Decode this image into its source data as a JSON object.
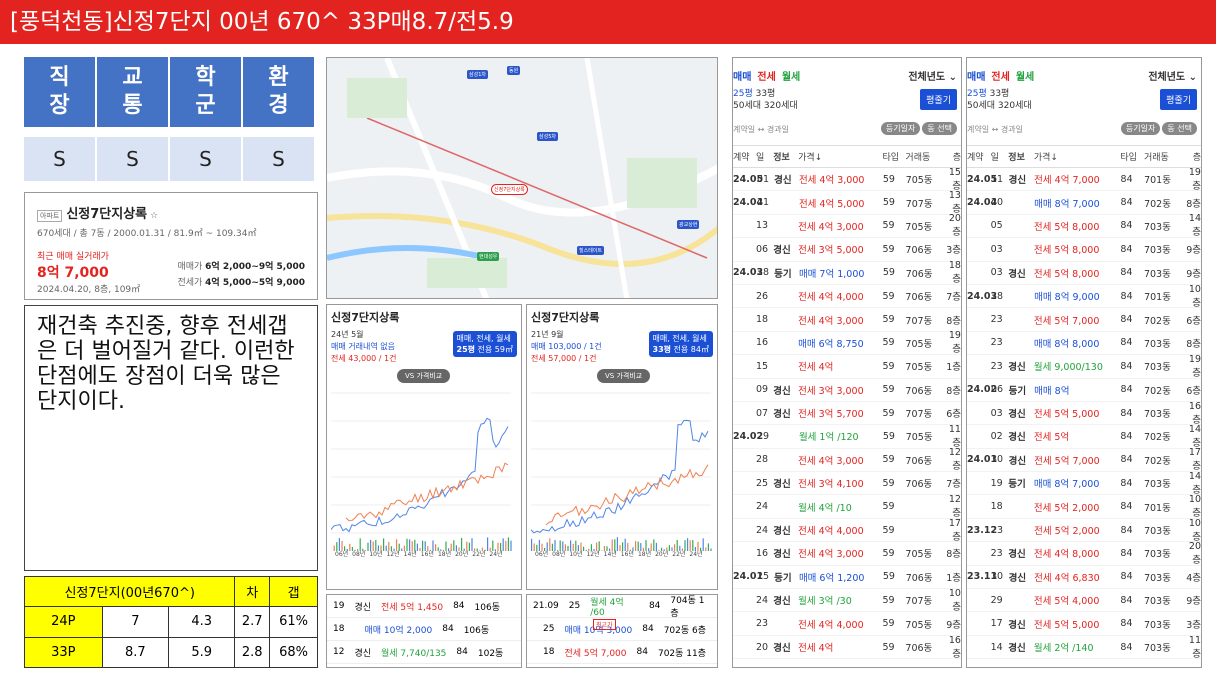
{
  "title": "[풍덕천동]신정7단지 00년 670^ 33P매8.7/전5.9",
  "categories": [
    {
      "head": "직\n장",
      "val": "S"
    },
    {
      "head": "교\n통",
      "val": "S"
    },
    {
      "head": "학\n군",
      "val": "S"
    },
    {
      "head": "환\n경",
      "val": "S"
    }
  ],
  "summary": {
    "badge": "아파트",
    "name": "신정7단지상록",
    "star": "☆",
    "info": "670세대 / 총 7동 / 2000.01.31 / 81.9㎡ ~ 109.34㎡",
    "recent_label": "최근 매매 실거래가",
    "recent_price": "8억 7,000",
    "recent_date": "2024.04.20, 8층, 109㎡",
    "sale_label": "매매가",
    "sale_range": "6억 2,000~9억 5,000",
    "jeonse_label": "전세가",
    "jeonse_range": "4억 5,000~5억 9,000"
  },
  "comment": "재건축 추진중, 향후 전세갭은 더 벌어질거 같다. 이런한 단점에도 장점이 더욱 많은 단지이다.",
  "ytable": {
    "header": [
      "신정7단지(00년670^)",
      "",
      "",
      "차",
      "갭"
    ],
    "rows": [
      [
        "24P",
        "7",
        "4.3",
        "2.7",
        "61%"
      ],
      [
        "33P",
        "8.7",
        "5.9",
        "2.8",
        "68%"
      ]
    ]
  },
  "map": {
    "pins": [
      {
        "label": "삼성1차"
      },
      {
        "label": "동원"
      },
      {
        "label": "신정7단지상록",
        "highlight": true
      },
      {
        "label": "현대성우"
      },
      {
        "label": "힐스테이트"
      },
      {
        "label": "삼성5차"
      },
      {
        "label": "광교상현"
      }
    ]
  },
  "chart1": {
    "title": "신정7단지상록",
    "month": "24년 5월",
    "line1": "매매 거래내역 없음",
    "line2": "전세 43,000 / 1건",
    "btn": "매매, 전세, 월세",
    "size": "25평",
    "sizesub": "전용 59㎡",
    "vs": "VS 가격비교",
    "years": [
      "06년",
      "08년",
      "10년",
      "12년",
      "14년",
      "16년",
      "18년",
      "20년",
      "22년",
      "24년"
    ]
  },
  "chart2": {
    "title": "신정7단지상록",
    "month": "21년 9월",
    "line1": "매매 103,000 / 1건",
    "line2": "전세 57,000 / 1건",
    "btn": "매매, 전세, 월세",
    "size": "33평",
    "sizesub": "전용 84㎡",
    "vs": "VS 가격비교",
    "years": [
      "06년",
      "08년",
      "10년",
      "12년",
      "14년",
      "16년",
      "18년",
      "20년",
      "22년",
      "24년"
    ]
  },
  "bottom1": [
    [
      "19",
      "경신",
      "전세 5억 1,450",
      "84",
      "106동"
    ],
    [
      "18",
      "",
      "매매 10억 2,000",
      "84",
      "106동"
    ],
    [
      "12",
      "경신",
      "월세 7,740/135",
      "84",
      "102동"
    ]
  ],
  "bottom2": [
    [
      "21.09",
      "25",
      "월세 4억 /60",
      "84",
      "704동 1층"
    ],
    [
      "",
      "25",
      "매매 10억 3,000",
      "84",
      "702동 6층"
    ],
    [
      "",
      "18",
      "전세 5억 7,000",
      "84",
      "702동 11층"
    ]
  ],
  "bottom2_tag": "최고가",
  "tx1": {
    "tabs": [
      "매매",
      "전세",
      "월세"
    ],
    "year": "전체년도 ⌄",
    "sizes": [
      [
        "25평",
        "33평"
      ],
      [
        "50세대",
        "320세대"
      ]
    ],
    "btn": "평줄기",
    "sub": "계약일 ↔ 경과일",
    "chips": [
      "등기일자",
      "동 선택"
    ],
    "cols": [
      "계약",
      "일",
      "정보",
      "가격↓",
      "타입",
      "거래동",
      "층"
    ],
    "rows": [
      [
        "24.05",
        "01",
        "경신",
        "전세 4억 3,000",
        "59",
        "705동",
        "15층"
      ],
      [
        "24.04",
        "21",
        "",
        "전세 4억 5,000",
        "59",
        "707동",
        "13층"
      ],
      [
        "",
        "13",
        "",
        "전세 4억 3,000",
        "59",
        "705동",
        "20층"
      ],
      [
        "",
        "06",
        "경신",
        "전세 3억 5,000",
        "59",
        "706동",
        "3층"
      ],
      [
        "24.03",
        "28",
        "등기",
        "매매 7억 1,000",
        "59",
        "706동",
        "18층"
      ],
      [
        "",
        "26",
        "",
        "전세 4억 4,000",
        "59",
        "706동",
        "7층"
      ],
      [
        "",
        "18",
        "",
        "전세 4억 3,000",
        "59",
        "707동",
        "8층"
      ],
      [
        "",
        "16",
        "",
        "매매 6억 8,750",
        "59",
        "705동",
        "19층"
      ],
      [
        "",
        "15",
        "",
        "전세 4억",
        "59",
        "705동",
        "1층"
      ],
      [
        "",
        "09",
        "경신",
        "전세 3억 3,000",
        "59",
        "706동",
        "8층"
      ],
      [
        "",
        "07",
        "경신",
        "전세 3억 5,700",
        "59",
        "707동",
        "6층"
      ],
      [
        "24.02",
        "29",
        "",
        "월세 1억 /120",
        "59",
        "705동",
        "11층"
      ],
      [
        "",
        "28",
        "",
        "전세 4억 3,000",
        "59",
        "706동",
        "12층"
      ],
      [
        "",
        "25",
        "경신",
        "전세 3억 4,100",
        "59",
        "706동",
        "7층"
      ],
      [
        "",
        "24",
        "",
        "월세 4억 /10",
        "59",
        "",
        "12층"
      ],
      [
        "",
        "24",
        "경신",
        "전세 4억 4,000",
        "59",
        "",
        "17층"
      ],
      [
        "",
        "16",
        "경신",
        "전세 4억 3,000",
        "59",
        "705동",
        "8층"
      ],
      [
        "24.01",
        "25",
        "등기",
        "매매 6억 1,200",
        "59",
        "706동",
        "1층"
      ],
      [
        "",
        "24",
        "경신",
        "월세 3억 /30",
        "59",
        "707동",
        "10층"
      ],
      [
        "",
        "23",
        "",
        "전세 4억 4,000",
        "59",
        "705동",
        "9층"
      ],
      [
        "",
        "20",
        "경신",
        "전세 4억",
        "59",
        "706동",
        "16층"
      ]
    ]
  },
  "tx2": {
    "tabs": [
      "매매",
      "전세",
      "월세"
    ],
    "year": "전체년도 ⌄",
    "sizes": [
      [
        "25평",
        "33평"
      ],
      [
        "50세대",
        "320세대"
      ]
    ],
    "btn": "평줄기",
    "sub": "계약일 ↔ 경과일",
    "chips": [
      "등기일자",
      "동 선택"
    ],
    "cols": [
      "계약",
      "일",
      "정보",
      "가격↓",
      "타입",
      "거래동",
      "층"
    ],
    "rows": [
      [
        "24.05",
        "11",
        "경신",
        "전세 4억 7,000",
        "84",
        "701동",
        "19층"
      ],
      [
        "24.04",
        "20",
        "",
        "매매 8억 7,000",
        "84",
        "702동",
        "8층"
      ],
      [
        "",
        "05",
        "",
        "전세 5억 8,000",
        "84",
        "703동",
        "14층"
      ],
      [
        "",
        "03",
        "",
        "전세 5억 8,000",
        "84",
        "703동",
        "9층"
      ],
      [
        "",
        "03",
        "경신",
        "전세 5억 8,000",
        "84",
        "703동",
        "9층"
      ],
      [
        "24.03",
        "28",
        "",
        "매매 8억 9,000",
        "84",
        "701동",
        "10층"
      ],
      [
        "",
        "23",
        "",
        "전세 5억 7,000",
        "84",
        "702동",
        "6층"
      ],
      [
        "",
        "23",
        "",
        "매매 8억 8,000",
        "84",
        "703동",
        "8층"
      ],
      [
        "",
        "23",
        "경신",
        "월세 9,000/130",
        "84",
        "703동",
        "19층"
      ],
      [
        "24.02",
        "06",
        "등기",
        "매매 8억",
        "84",
        "702동",
        "6층"
      ],
      [
        "",
        "03",
        "경신",
        "전세 5억 5,000",
        "84",
        "703동",
        "16층"
      ],
      [
        "",
        "02",
        "경신",
        "전세 5억",
        "84",
        "702동",
        "14층"
      ],
      [
        "24.01",
        "30",
        "경신",
        "전세 5억 7,000",
        "84",
        "702동",
        "17층"
      ],
      [
        "",
        "19",
        "등기",
        "매매 8억 7,000",
        "84",
        "703동",
        "14층"
      ],
      [
        "",
        "18",
        "",
        "전세 5억 2,000",
        "84",
        "701동",
        "10층"
      ],
      [
        "23.12",
        "23",
        "",
        "전세 5억 2,000",
        "84",
        "703동",
        "10층"
      ],
      [
        "",
        "23",
        "경신",
        "전세 4억 8,000",
        "84",
        "703동",
        "20층"
      ],
      [
        "23.11",
        "30",
        "경신",
        "전세 4억 6,830",
        "84",
        "703동",
        "4층"
      ],
      [
        "",
        "29",
        "",
        "전세 5억 4,000",
        "84",
        "703동",
        "9층"
      ],
      [
        "",
        "17",
        "경신",
        "전세 5억 5,000",
        "84",
        "703동",
        "3층"
      ],
      [
        "",
        "14",
        "경신",
        "월세 2억 /140",
        "84",
        "703동",
        "11층"
      ]
    ]
  }
}
